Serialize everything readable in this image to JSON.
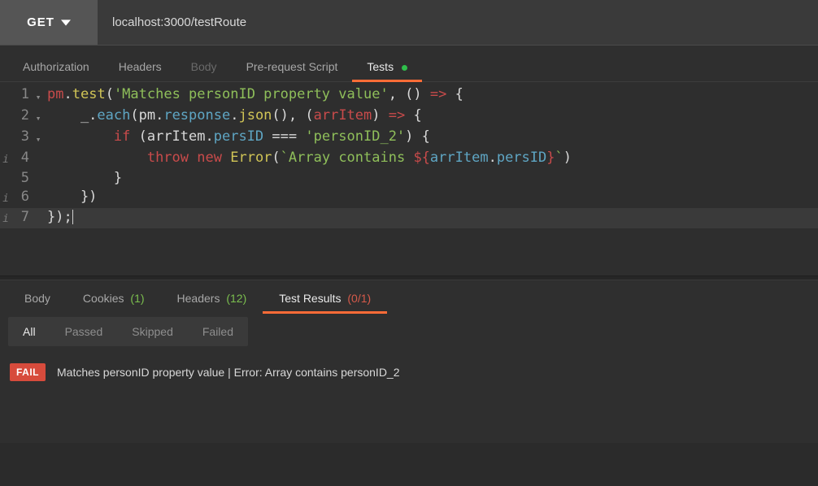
{
  "toolbar": {
    "method": "GET",
    "url": "localhost:3000/testRoute"
  },
  "reqTabs": {
    "auth": "Authorization",
    "headers": "Headers",
    "body": "Body",
    "pre": "Pre-request Script",
    "tests": "Tests"
  },
  "code": {
    "l1": {
      "a": "pm",
      "b": ".",
      "c": "test",
      "d": "(",
      "e": "'Matches personID property value'",
      "f": ", () ",
      "g": "=>",
      "h": " {"
    },
    "l2": {
      "a": "    _.",
      "b": "each",
      "c": "(pm.",
      "d": "response",
      "e": ".",
      "f": "json",
      "g": "(), (",
      "h": "arrItem",
      "i": ") ",
      "j": "=>",
      "k": " {"
    },
    "l3": {
      "a": "        ",
      "b": "if",
      "c": " (arrItem.",
      "d": "persID",
      "e": " === ",
      "f": "'personID_2'",
      "g": ") {"
    },
    "l4": {
      "a": "            ",
      "b": "throw",
      "c": " ",
      "d": "new",
      "e": " ",
      "f": "Error",
      "g": "(",
      "h": "`Array contains ",
      "i": "${",
      "j": "arrItem",
      "k": ".",
      "l": "persID",
      "m": "}",
      "n": "`",
      "o": ")"
    },
    "l5": {
      "a": "        }"
    },
    "l6": {
      "a": "    })"
    },
    "l7": {
      "a": "});"
    }
  },
  "resTabs": {
    "body": "Body",
    "cookies": "Cookies",
    "cookiesCount": "(1)",
    "headers": "Headers",
    "headersCount": "(12)",
    "tests": "Test Results",
    "testsCount": "(0/1)"
  },
  "filters": {
    "all": "All",
    "passed": "Passed",
    "skipped": "Skipped",
    "failed": "Failed"
  },
  "result": {
    "badge": "FAIL",
    "msg": "Matches personID property value | Error: Array contains personID_2"
  }
}
